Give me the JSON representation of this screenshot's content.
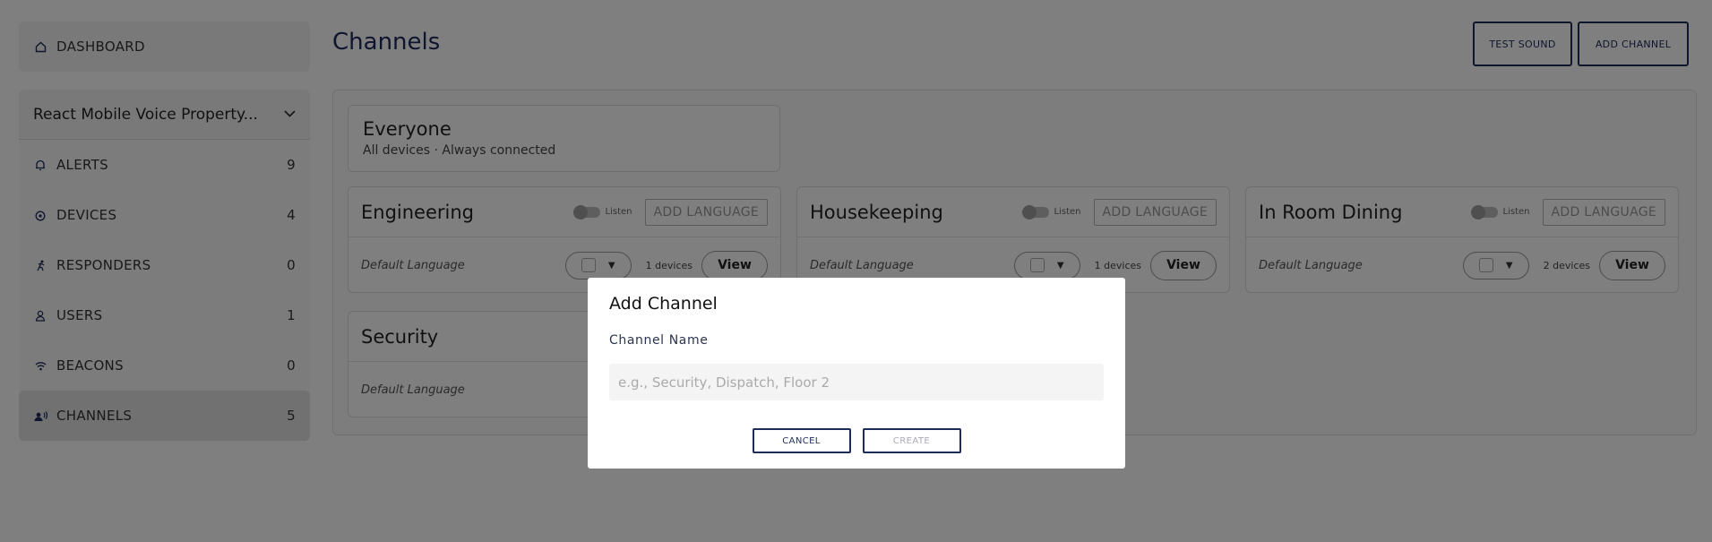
{
  "header": {
    "title": "Channels",
    "test_sound_label": "TEST SOUND",
    "add_channel_label": "ADD CHANNEL"
  },
  "sidebar": {
    "dashboard": {
      "label": "DASHBOARD",
      "icon": "home-icon"
    },
    "property_select": {
      "value": "React Mobile Voice Property..."
    },
    "items": [
      {
        "label": "ALERTS",
        "count": "9",
        "icon": "bell-icon"
      },
      {
        "label": "DEVICES",
        "count": "4",
        "icon": "device-icon"
      },
      {
        "label": "RESPONDERS",
        "count": "0",
        "icon": "runner-icon"
      },
      {
        "label": "USERS",
        "count": "1",
        "icon": "user-icon"
      },
      {
        "label": "BEACONS",
        "count": "0",
        "icon": "wifi-icon"
      },
      {
        "label": "CHANNELS",
        "count": "5",
        "icon": "channel-icon"
      }
    ]
  },
  "everyone": {
    "title": "Everyone",
    "subtitle": "All devices · Always connected"
  },
  "channels": [
    {
      "name": "Engineering",
      "listen_label": "Listen",
      "add_language_label": "ADD LANGUAGE",
      "default_language_label": "Default Language",
      "devices": "1 devices",
      "view_label": "View"
    },
    {
      "name": "Housekeeping",
      "listen_label": "Listen",
      "add_language_label": "ADD LANGUAGE",
      "default_language_label": "Default Language",
      "devices": "1 devices",
      "view_label": "View"
    },
    {
      "name": "In Room Dining",
      "listen_label": "Listen",
      "add_language_label": "ADD LANGUAGE",
      "default_language_label": "Default Language",
      "devices": "2 devices",
      "view_label": "View"
    },
    {
      "name": "Security",
      "default_language_label": "Default Language"
    }
  ],
  "modal": {
    "title": "Add Channel",
    "field_label": "Channel Name",
    "placeholder": "e.g., Security, Dispatch, Floor 2",
    "value": "",
    "cancel_label": "CANCEL",
    "create_label": "CREATE"
  },
  "colors": {
    "accent": "#1c2b5a",
    "overlay": "rgba(0,0,0,0.5)"
  }
}
